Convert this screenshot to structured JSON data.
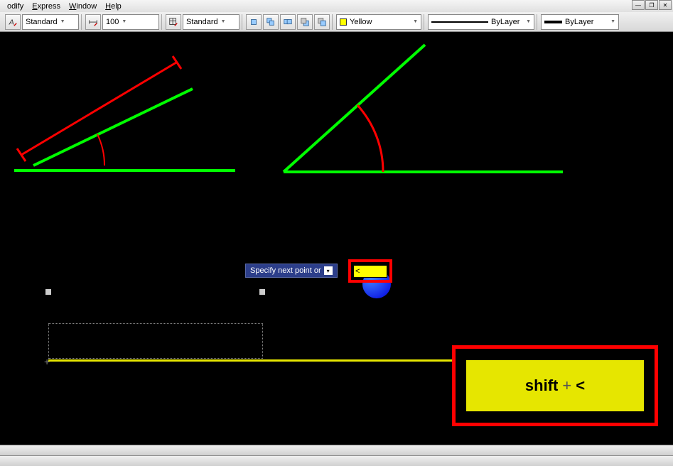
{
  "menu": {
    "items": [
      "odify",
      "Express",
      "Window",
      "Help"
    ]
  },
  "toolbar": {
    "style1": "Standard",
    "scale": "100",
    "style2": "Standard",
    "color": {
      "name": "Yellow",
      "hex": "#ffff00"
    },
    "linetype": "ByLayer",
    "lineweight": "ByLayer"
  },
  "prompt": {
    "text": "Specify next point or"
  },
  "dynamic_input": {
    "value": "<"
  },
  "callout": {
    "key1": "shift",
    "op": "+",
    "key2": "<"
  },
  "chart_data": {
    "type": "diagram",
    "elements": [
      {
        "kind": "line",
        "color": "#00ff00",
        "from": [
          20,
          239
        ],
        "to": [
          331,
          239
        ]
      },
      {
        "kind": "line",
        "color": "#00ff00",
        "from": [
          47,
          232
        ],
        "to": [
          271,
          125
        ]
      },
      {
        "kind": "line",
        "color": "#ff0000",
        "from": [
          30,
          217
        ],
        "to": [
          248,
          88
        ]
      },
      {
        "kind": "line",
        "color": "#ff0000",
        "from": [
          24,
          208
        ],
        "to": [
          36,
          226
        ]
      },
      {
        "kind": "line",
        "color": "#ff0000",
        "from": [
          243,
          78
        ],
        "to": [
          255,
          96
        ]
      },
      {
        "kind": "arc",
        "color": "#ff0000",
        "center": [
          47,
          232
        ],
        "radius": 100,
        "a0": 0,
        "a1": -25
      },
      {
        "kind": "line",
        "color": "#00ff00",
        "from": [
          399,
          241
        ],
        "to": [
          598,
          63
        ]
      },
      {
        "kind": "line",
        "color": "#00ff00",
        "from": [
          399,
          241
        ],
        "to": [
          792,
          241
        ]
      },
      {
        "kind": "arc",
        "color": "#ff0000",
        "center": [
          399,
          241
        ],
        "radius": 140,
        "a0": 0,
        "a1": -42
      }
    ]
  }
}
